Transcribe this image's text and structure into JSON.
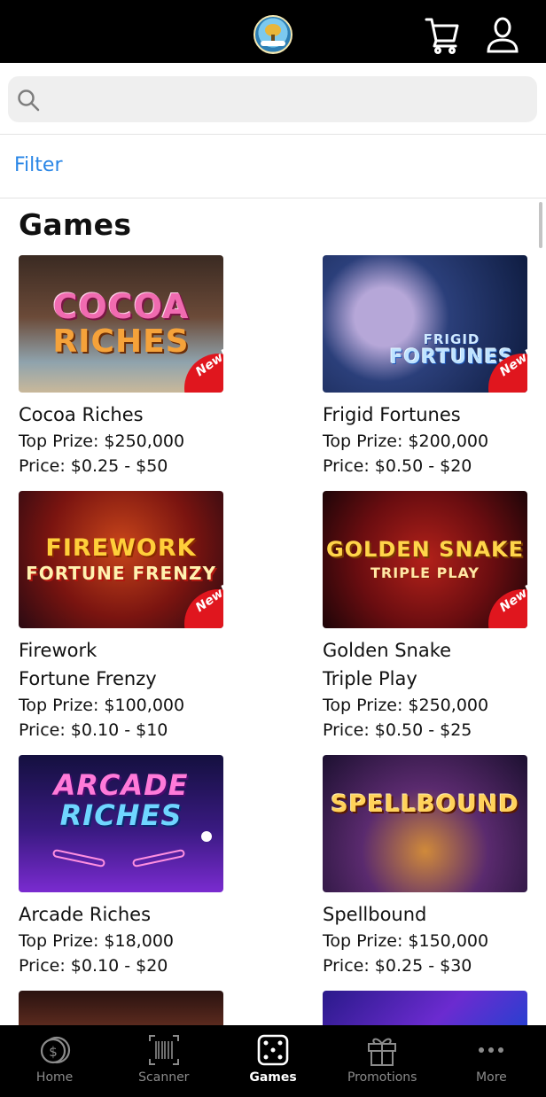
{
  "header": {
    "logo": "lottery-logo",
    "cart_icon": "cart-icon",
    "account_icon": "user-icon"
  },
  "search": {
    "placeholder": "",
    "value": ""
  },
  "filter": {
    "label": "Filter"
  },
  "section": {
    "title": "Games"
  },
  "colors": {
    "accent": "#2a86e6",
    "new_badge": "#e0161e",
    "bar": "#000000"
  },
  "games": [
    {
      "art_line1": "COCOA",
      "art_line2": "RICHES",
      "badge": "New!",
      "title_line1": "Cocoa Riches",
      "title_line2": "",
      "top_prize": "Top Prize: $250,000",
      "price": "Price: $0.25 - $50"
    },
    {
      "art_line1": "FRIGID",
      "art_line2": "FORTUNES",
      "badge": "New!",
      "title_line1": "Frigid Fortunes",
      "title_line2": "",
      "top_prize": "Top Prize: $200,000",
      "price": "Price: $0.50 - $20"
    },
    {
      "art_line1": "FIREWORK",
      "art_line2": "FORTUNE FRENZY",
      "badge": "New!",
      "title_line1": "Firework",
      "title_line2": "Fortune Frenzy",
      "top_prize": "Top Prize: $100,000",
      "price": "Price: $0.10 - $10"
    },
    {
      "art_line1": "GOLDEN SNAKE",
      "art_line2": "TRIPLE PLAY",
      "badge": "New!",
      "title_line1": "Golden Snake",
      "title_line2": "Triple Play",
      "top_prize": "Top Prize: $250,000",
      "price": "Price: $0.50 - $25"
    },
    {
      "art_line1": "ARCADE",
      "art_line2": "RICHES",
      "badge": "",
      "title_line1": "Arcade Riches",
      "title_line2": "",
      "top_prize": "Top Prize: $18,000",
      "price": "Price: $0.10 - $20"
    },
    {
      "art_line1": "SPELLBOUND",
      "art_line2": "",
      "badge": "",
      "title_line1": "Spellbound",
      "title_line2": "",
      "top_prize": "Top Prize: $150,000",
      "price": "Price: $0.25 - $30"
    }
  ],
  "nav": [
    {
      "label": "Home",
      "icon": "home-coin-icon"
    },
    {
      "label": "Scanner",
      "icon": "barcode-scanner-icon"
    },
    {
      "label": "Games",
      "icon": "dice-icon",
      "active": true
    },
    {
      "label": "Promotions",
      "icon": "gift-icon"
    },
    {
      "label": "More",
      "icon": "more-dots-icon"
    }
  ]
}
